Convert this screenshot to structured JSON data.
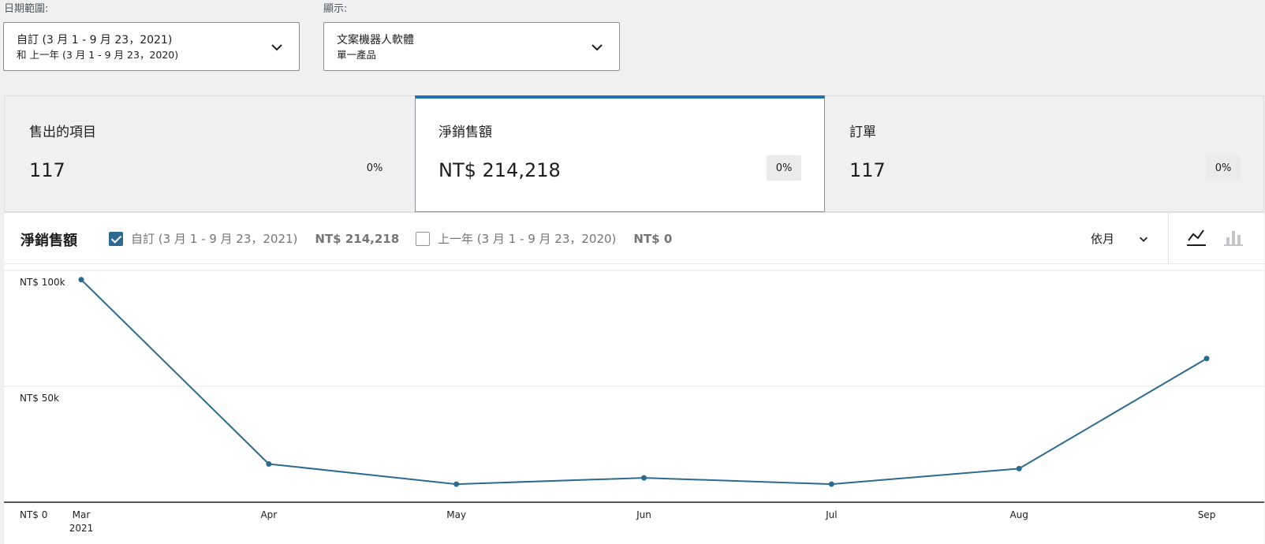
{
  "filters": {
    "date_label": "日期範圍:",
    "date_line1": "自訂 (3 月 1 - 9 月 23，2021)",
    "date_line2": "和 上一年 (3 月 1 - 9 月 23，2020)",
    "show_label": "顯示:",
    "show_line1": "文案機器人軟體",
    "show_line2": "單一產品"
  },
  "summary": [
    {
      "title": "售出的項目",
      "value": "117",
      "delta": "0%"
    },
    {
      "title": "淨銷售額",
      "value": "NT$ 214,218",
      "delta": "0%",
      "selected": true
    },
    {
      "title": "訂單",
      "value": "117",
      "delta": "0%"
    }
  ],
  "chart_header": {
    "title": "淨銷售額",
    "series1_label": "自訂 (3 月 1 - 9 月 23，2021)",
    "series1_total": "NT$ 214,218",
    "series2_label": "上一年 (3 月 1 - 9 月 23，2020)",
    "series2_total": "NT$ 0",
    "interval": "依月"
  },
  "colors": {
    "accent": "#2c6a8f",
    "tab_active": "#2271b1",
    "line": "#2c6a8f"
  },
  "icons": {
    "line_chart": "line-chart-icon",
    "bar_chart": "bar-chart-icon",
    "chevron": "chevron-down-icon"
  },
  "chart_data": {
    "type": "line",
    "categories": [
      "Mar",
      "Apr",
      "May",
      "Jun",
      "Jul",
      "Aug",
      "Sep"
    ],
    "x_sublabel": "2021",
    "yticks": [
      "NT$ 0",
      "NT$ 50k",
      "NT$ 100k"
    ],
    "ylim": [
      0,
      100000
    ],
    "series": [
      {
        "values": [
          96000,
          16500,
          7800,
          10500,
          7800,
          14500,
          62000
        ]
      }
    ],
    "grid": true
  }
}
